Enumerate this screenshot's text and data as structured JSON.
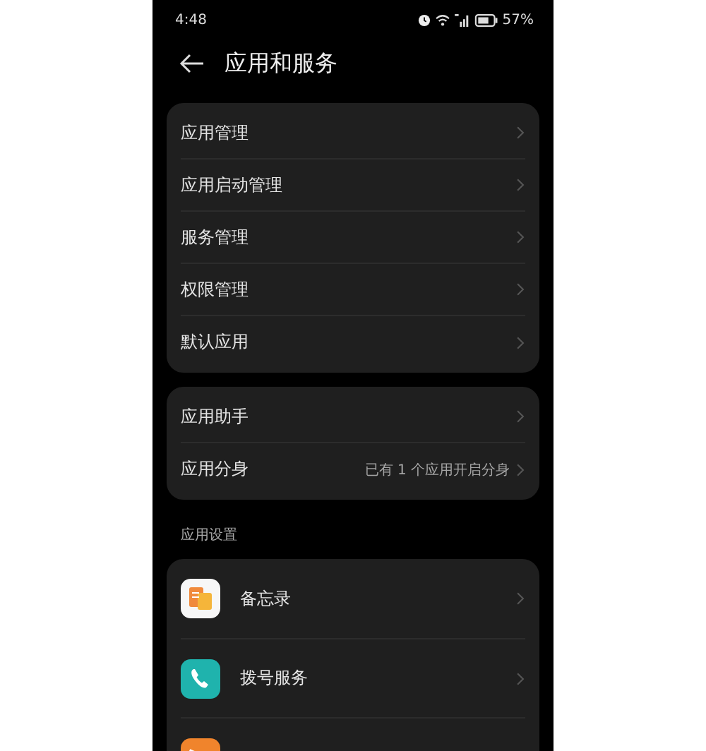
{
  "status_bar": {
    "time": "4:48",
    "battery": "57%"
  },
  "header": {
    "title": "应用和服务"
  },
  "groups": [
    {
      "items": [
        {
          "label": "应用管理"
        },
        {
          "label": "应用启动管理"
        },
        {
          "label": "服务管理"
        },
        {
          "label": "权限管理"
        },
        {
          "label": "默认应用"
        }
      ]
    },
    {
      "items": [
        {
          "label": "应用助手"
        },
        {
          "label": "应用分身",
          "value": "已有 1 个应用开启分身"
        }
      ]
    }
  ],
  "section": {
    "title": "应用设置",
    "apps": [
      {
        "kind": "notes",
        "label": "备忘录"
      },
      {
        "kind": "phone",
        "label": "拨号服务"
      },
      {
        "kind": "video"
      }
    ]
  }
}
